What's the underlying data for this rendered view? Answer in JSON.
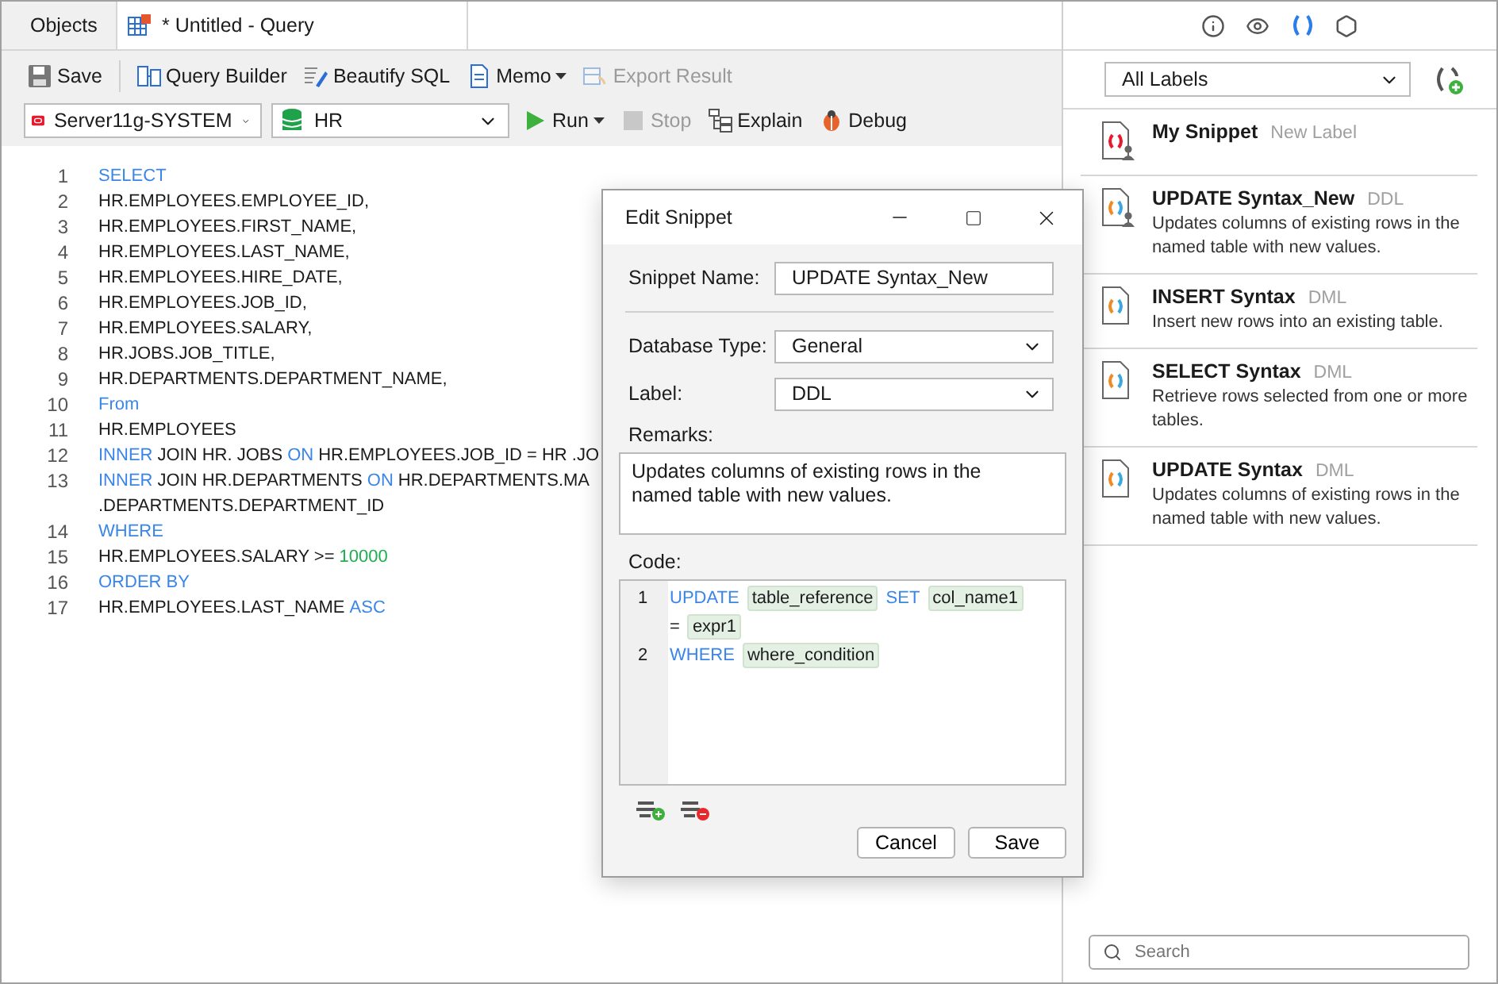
{
  "tabs": [
    {
      "label": "Objects",
      "selected": false,
      "kind": "plain"
    },
    {
      "label": "* Untitled - Query",
      "selected": true,
      "kind": "query"
    }
  ],
  "toolbar": [
    {
      "label": "Save",
      "kind": "save",
      "disabled": false,
      "menu": false
    },
    {
      "label": "Query Builder",
      "kind": "builder",
      "disabled": false,
      "menu": false
    },
    {
      "label": "Beautify SQL",
      "kind": "beautify",
      "disabled": false,
      "menu": false
    },
    {
      "label": "Memo",
      "kind": "memo",
      "disabled": false,
      "menu": true
    },
    {
      "label": "Export Result",
      "kind": "export",
      "disabled": true,
      "menu": false
    }
  ],
  "connection": {
    "value": "Server11g-SYSTEM"
  },
  "database": {
    "value": "HR"
  },
  "actions": [
    {
      "label": "Run",
      "kind": "run",
      "disabled": false,
      "menu": true
    },
    {
      "label": "Stop",
      "kind": "stop",
      "disabled": true,
      "menu": false
    },
    {
      "label": "Explain",
      "kind": "explain",
      "disabled": false,
      "menu": false
    },
    {
      "label": "Debug",
      "kind": "debug",
      "disabled": false,
      "menu": false
    }
  ],
  "editor": {
    "lines": [
      {
        "number": "1",
        "tokens": [
          {
            "text": "SELECT",
            "kind": "keyword"
          }
        ]
      },
      {
        "number": "2",
        "tokens": [
          {
            "text": "HR.EMPLOYEES.EMPLOYEE_ID,",
            "kind": "plain"
          }
        ]
      },
      {
        "number": "3",
        "tokens": [
          {
            "text": "HR.EMPLOYEES.FIRST_NAME,",
            "kind": "plain"
          }
        ]
      },
      {
        "number": "4",
        "tokens": [
          {
            "text": "HR.EMPLOYEES.LAST_NAME,",
            "kind": "plain"
          }
        ]
      },
      {
        "number": "5",
        "tokens": [
          {
            "text": "HR.EMPLOYEES.HIRE_DATE,",
            "kind": "plain"
          }
        ]
      },
      {
        "number": "6",
        "tokens": [
          {
            "text": "HR.EMPLOYEES.JOB_ID,",
            "kind": "plain"
          }
        ]
      },
      {
        "number": "7",
        "tokens": [
          {
            "text": "HR.EMPLOYEES.SALARY,",
            "kind": "plain"
          }
        ]
      },
      {
        "number": "8",
        "tokens": [
          {
            "text": "HR.JOBS.JOB_TITLE,",
            "kind": "plain"
          }
        ]
      },
      {
        "number": "9",
        "tokens": [
          {
            "text": "HR.DEPARTMENTS.DEPARTMENT_NAME,",
            "kind": "plain"
          }
        ]
      },
      {
        "number": "10",
        "tokens": [
          {
            "text": "From",
            "kind": "keyword"
          }
        ]
      },
      {
        "number": "11",
        "tokens": [
          {
            "text": "HR.EMPLOYEES",
            "kind": "plain"
          }
        ]
      },
      {
        "number": "12",
        "tokens": [
          {
            "text": "INNER",
            "kind": "keyword"
          },
          {
            "text": "JOIN HR. JOBS",
            "kind": "plain"
          },
          {
            "text": "ON",
            "kind": "keyword"
          },
          {
            "text": "HR.EMPLOYEES.JOB_ID = HR .JO",
            "kind": "plain"
          }
        ]
      },
      {
        "number": "13",
        "tokens": [
          {
            "text": "INNER",
            "kind": "keyword"
          },
          {
            "text": "JOIN HR.DEPARTMENTS",
            "kind": "plain"
          },
          {
            "text": "ON",
            "kind": "keyword"
          },
          {
            "text": "HR.DEPARTMENTS.MA",
            "kind": "plain"
          }
        ]
      },
      {
        "tokens": [
          {
            "text": ".DEPARTMENTS.DEPARTMENT_ID",
            "kind": "plain"
          }
        ]
      },
      {
        "number": "14",
        "tokens": [
          {
            "text": "WHERE",
            "kind": "keyword"
          }
        ]
      },
      {
        "number": "15",
        "tokens": [
          {
            "text": "HR.EMPLOYEES.SALARY >=",
            "kind": "plain"
          },
          {
            "text": "10000",
            "kind": "number"
          }
        ]
      },
      {
        "number": "16",
        "tokens": [
          {
            "text": "ORDER BY",
            "kind": "keyword"
          }
        ]
      },
      {
        "number": "17",
        "tokens": [
          {
            "text": "HR.EMPLOYEES.LAST_NAME",
            "kind": "plain"
          },
          {
            "text": "ASC",
            "kind": "keyword"
          }
        ]
      }
    ]
  },
  "dialog": {
    "title": "Edit Snippet",
    "snippet_name": {
      "label": "Snippet Name:",
      "value": "UPDATE Syntax_New"
    },
    "database_type": {
      "label": "Database Type:",
      "value": "General"
    },
    "label": {
      "label": "Label:",
      "value": "DDL"
    },
    "remarks": {
      "label": "Remarks:",
      "value": "Updates columns of existing rows in the named table with new values."
    },
    "code": {
      "label": "Code:",
      "lines": [
        {
          "number": "1",
          "tokens": [
            {
              "text": "UPDATE",
              "kind": "keyword"
            },
            {
              "text": "table_reference",
              "kind": "placeholder"
            },
            {
              "text": "SET",
              "kind": "keyword"
            },
            {
              "text": "col_name1",
              "kind": "placeholder"
            }
          ]
        },
        {
          "tokens": [
            {
              "text": "=",
              "kind": "plain"
            },
            {
              "text": "expr1",
              "kind": "placeholder"
            }
          ]
        },
        {
          "number": "2",
          "tokens": [
            {
              "text": "WHERE",
              "kind": "keyword"
            },
            {
              "text": "where_condition",
              "kind": "placeholder"
            }
          ]
        }
      ]
    },
    "buttons": [
      {
        "label": "Cancel"
      },
      {
        "label": "Save"
      }
    ]
  },
  "side_panel": {
    "tabs": [
      {
        "kind": "info",
        "selected": false
      },
      {
        "kind": "eye",
        "selected": false
      },
      {
        "kind": "snippet",
        "selected": true
      },
      {
        "kind": "hexagon",
        "selected": false
      }
    ],
    "label_filter": {
      "value": "All Labels"
    },
    "snippets": [
      {
        "name": "My Snippet",
        "label": "New Label",
        "kind": "empty",
        "user_defined": true
      },
      {
        "name": "UPDATE Syntax_New",
        "label": "DDL",
        "description": "Updates columns of existing rows in the named table with new values.",
        "kind": "syntax",
        "user_defined": true
      },
      {
        "name": "INSERT Syntax",
        "label": "DML",
        "description": "Insert new rows into an existing table.",
        "kind": "syntax",
        "user_defined": false
      },
      {
        "name": "SELECT Syntax",
        "label": "DML",
        "description": "Retrieve rows selected from one or more tables.",
        "kind": "syntax",
        "user_defined": false
      },
      {
        "name": "UPDATE Syntax",
        "label": "DML",
        "description": "Updates columns of existing rows in the named table with new values.",
        "kind": "syntax",
        "user_defined": false
      }
    ],
    "search": {
      "placeholder": "Search"
    }
  }
}
